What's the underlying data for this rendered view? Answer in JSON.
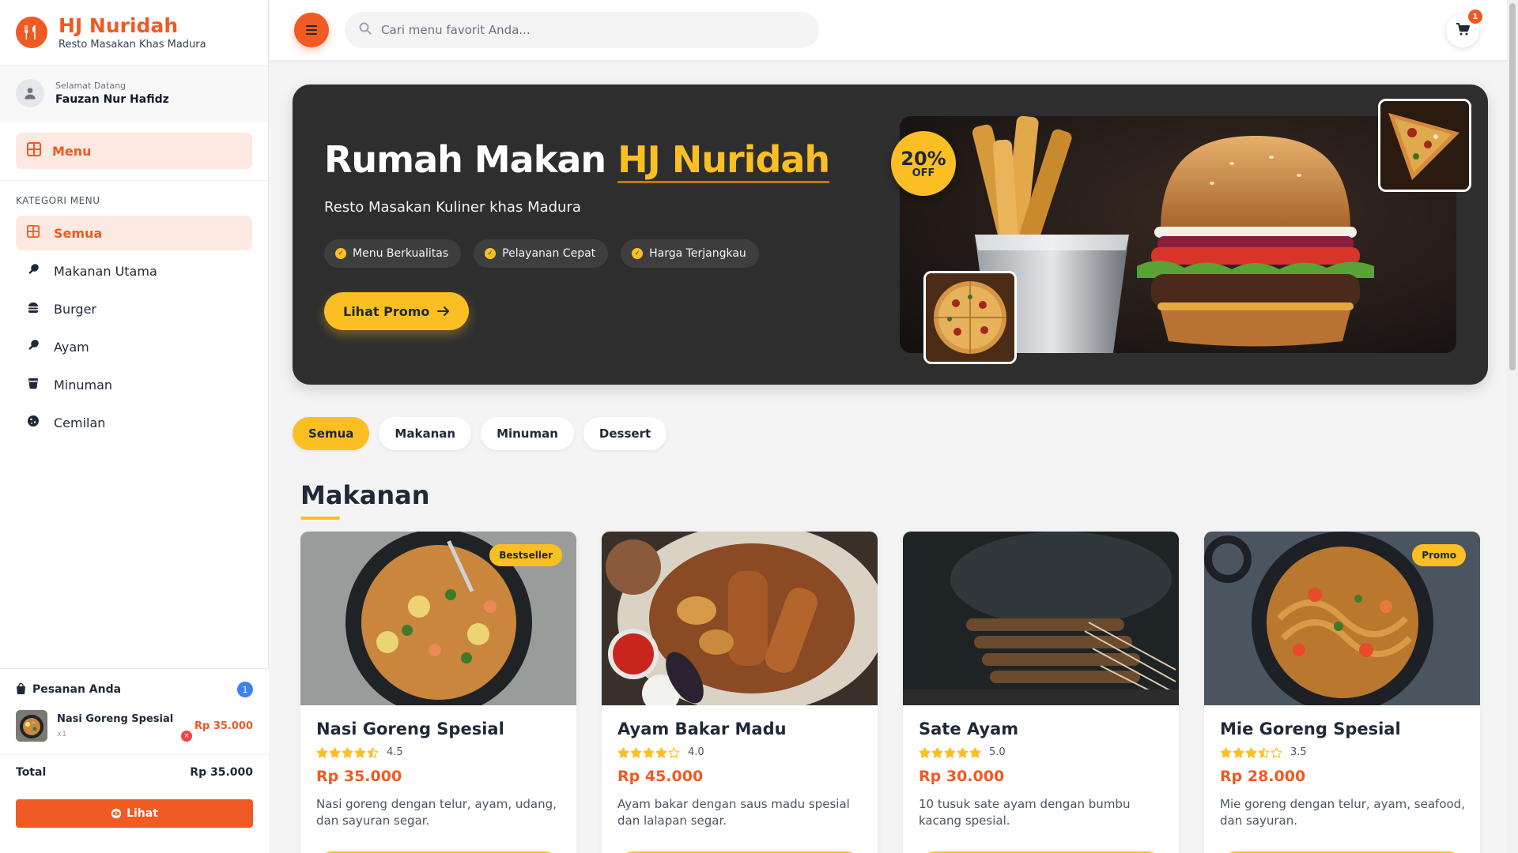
{
  "brand": {
    "title": "HJ Nuridah",
    "subtitle": "Resto Masakan Khas Madura"
  },
  "user": {
    "greeting": "Selamat Datang",
    "name": "Fauzan Nur Hafidz"
  },
  "nav": {
    "menu_label": "Menu"
  },
  "categories": {
    "title": "KATEGORI MENU",
    "items": [
      {
        "label": "Semua",
        "icon": "grid-icon",
        "active": true
      },
      {
        "label": "Makanan Utama",
        "icon": "drumstick-icon"
      },
      {
        "label": "Burger",
        "icon": "burger-icon"
      },
      {
        "label": "Ayam",
        "icon": "drumstick-icon"
      },
      {
        "label": "Minuman",
        "icon": "cup-icon"
      },
      {
        "label": "Cemilan",
        "icon": "cookie-icon"
      }
    ]
  },
  "order": {
    "title": "Pesanan Anda",
    "count": "1",
    "items": [
      {
        "name": "Nasi Goreng Spesial",
        "qty": "x1",
        "price": "Rp 35.000",
        "remove": "×"
      }
    ],
    "total_label": "Total",
    "total_value": "Rp 35.000",
    "view_label": "Lihat"
  },
  "search": {
    "placeholder": "Cari menu favorit Anda..."
  },
  "cart": {
    "count": "1"
  },
  "hero": {
    "title_prefix": "Rumah Makan ",
    "title_highlight": "HJ Nuridah",
    "subtitle": "Resto Masakan Kuliner khas Madura",
    "chips": [
      "Menu Berkualitas",
      "Pelayanan Cepat",
      "Harga Terjangkau"
    ],
    "promo_button": "Lihat Promo",
    "discount_pct": "20%",
    "discount_word": "OFF"
  },
  "filters": [
    "Semua",
    "Makanan",
    "Minuman",
    "Dessert"
  ],
  "section": {
    "title": "Makanan"
  },
  "products": [
    {
      "name": "Nasi Goreng Spesial",
      "rating": 4.5,
      "rating_text": "4.5",
      "price": "Rp 35.000",
      "desc": "Nasi goreng dengan telur, ayam, udang, dan sayuran segar.",
      "badge": "Bestseller"
    },
    {
      "name": "Ayam Bakar Madu",
      "rating": 4.0,
      "rating_text": "4.0",
      "price": "Rp 45.000",
      "desc": "Ayam bakar dengan saus madu spesial dan lalapan segar.",
      "badge": ""
    },
    {
      "name": "Sate Ayam",
      "rating": 5.0,
      "rating_text": "5.0",
      "price": "Rp 30.000",
      "desc": "10 tusuk sate ayam dengan bumbu kacang spesial.",
      "badge": ""
    },
    {
      "name": "Mie Goreng Spesial",
      "rating": 3.5,
      "rating_text": "3.5",
      "price": "Rp 28.000",
      "desc": "Mie goreng dengan telur, ayam, seafood, dan sayuran.",
      "badge": "Promo"
    }
  ],
  "colors": {
    "primary": "#f05a23",
    "accent": "#fbbf24",
    "hero_bg": "#2e2e2e"
  }
}
